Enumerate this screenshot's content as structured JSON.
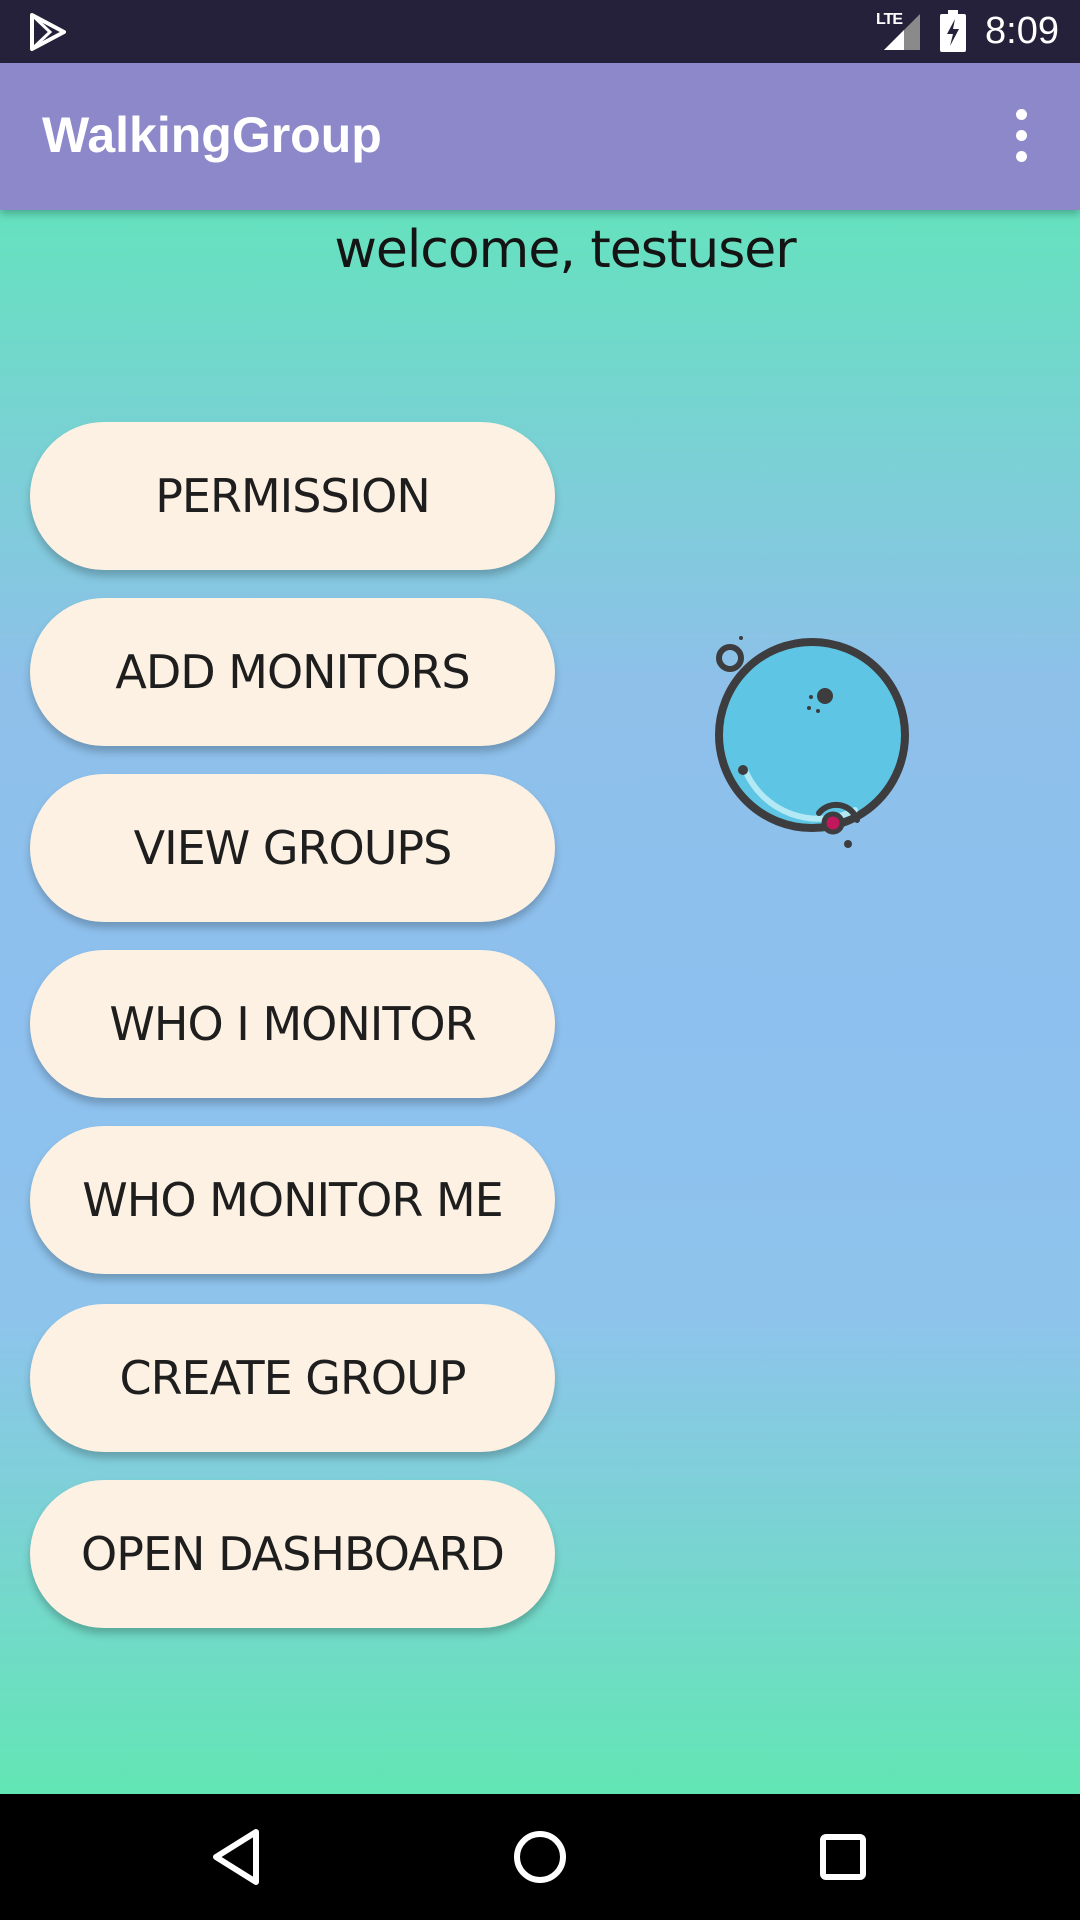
{
  "status_bar": {
    "network": "LTE",
    "time": "8:09",
    "icons": [
      "play-store-icon",
      "signal-icon",
      "battery-charging-icon"
    ]
  },
  "app_bar": {
    "title": "WalkingGroup",
    "overflow_icon": "more-vert-icon"
  },
  "main": {
    "welcome": "welcome, testuser",
    "buttons": [
      {
        "label": "PERMISSION"
      },
      {
        "label": "ADD MONITORS"
      },
      {
        "label": "VIEW GROUPS"
      },
      {
        "label": "WHO I MONITOR"
      },
      {
        "label": "WHO MONITOR ME"
      },
      {
        "label": "CREATE GROUP"
      },
      {
        "label": "OPEN DASHBOARD"
      }
    ],
    "illustration": "bubble-icon"
  },
  "nav_bar": {
    "icons": [
      "back-icon",
      "home-icon",
      "recents-icon"
    ]
  },
  "colors": {
    "status_bar": "#25213a",
    "app_bar": "#8c88c9",
    "button_bg": "#fcf1e2",
    "gradient_top": "#65e2be",
    "gradient_mid": "#8ec0ef",
    "gradient_bottom": "#62e6b4",
    "bubble_fill": "#5ec6e4",
    "bubble_accent": "#c2185b"
  }
}
